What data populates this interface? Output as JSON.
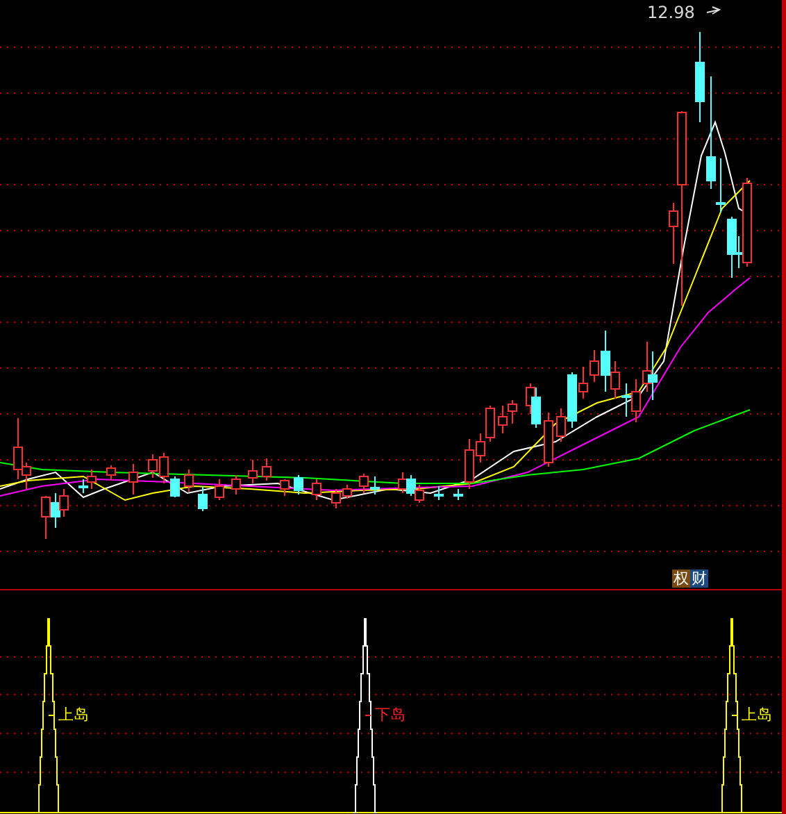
{
  "price_chart": {
    "high_label": "12.98",
    "badges": [
      {
        "text": "权",
        "color": "#7a4a12"
      },
      {
        "text": "财",
        "color": "#1b4a80"
      }
    ]
  },
  "signal_panel": {
    "signals": [
      {
        "label": "上岛",
        "kind": "up"
      },
      {
        "label": "下岛",
        "kind": "down"
      },
      {
        "label": "上岛",
        "kind": "up"
      }
    ]
  }
}
